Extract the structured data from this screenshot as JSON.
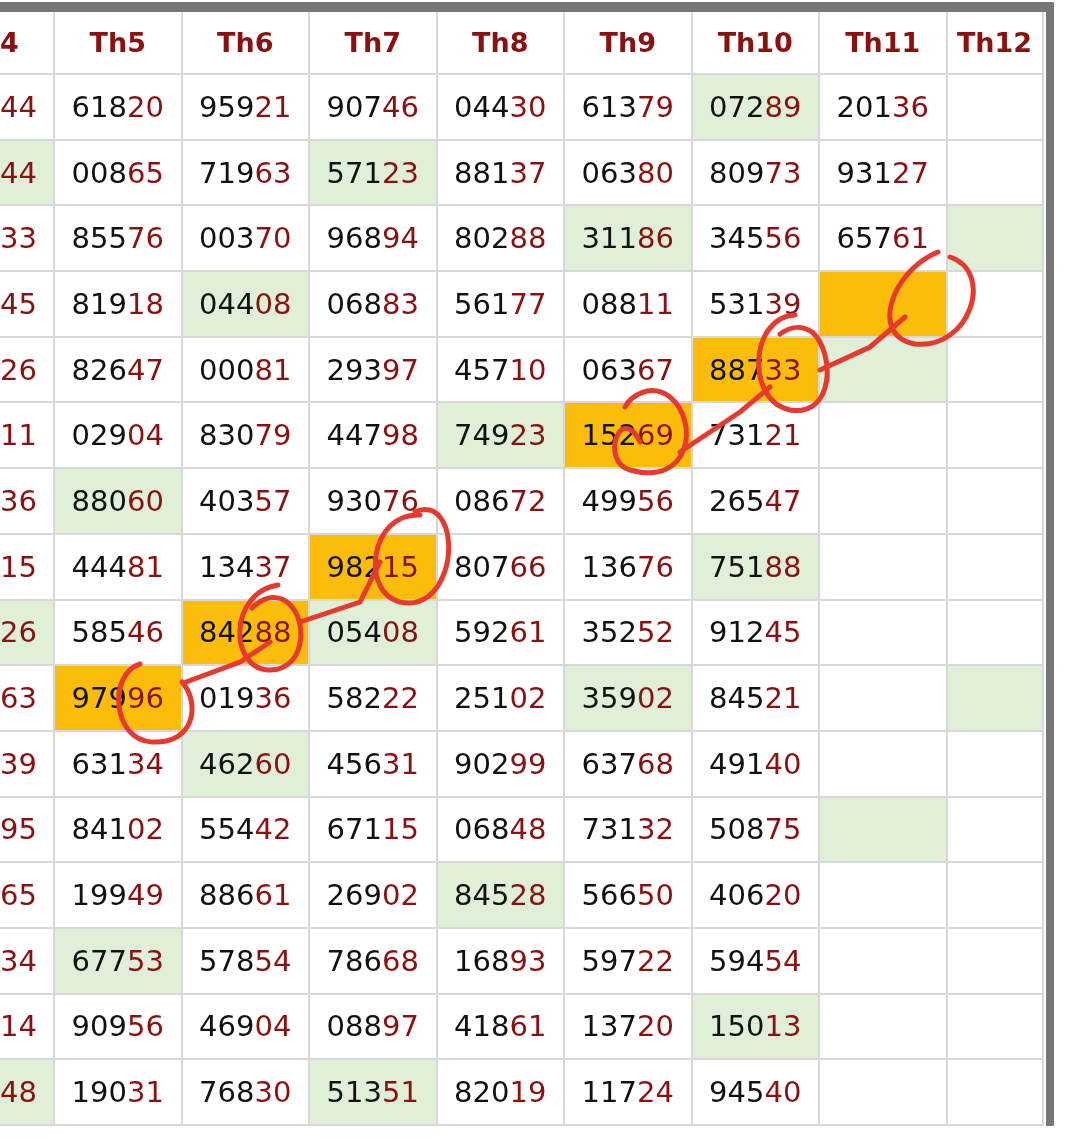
{
  "table": {
    "columns": [
      "4",
      "Th5",
      "Th6",
      "Th7",
      "Th8",
      "Th9",
      "Th10",
      "Th11",
      "Th12"
    ],
    "rows": [
      {
        "cells": [
          {
            "value": "44",
            "hit": false,
            "picked": false
          },
          {
            "value": "61820",
            "hit": false,
            "picked": false
          },
          {
            "value": "95921",
            "hit": false,
            "picked": false
          },
          {
            "value": "90746",
            "hit": false,
            "picked": false
          },
          {
            "value": "04430",
            "hit": false,
            "picked": false
          },
          {
            "value": "61379",
            "hit": false,
            "picked": false
          },
          {
            "value": "07289",
            "hit": true,
            "picked": false
          },
          {
            "value": "20136",
            "hit": false,
            "picked": false
          },
          {
            "hit": false,
            "picked": false
          }
        ]
      },
      {
        "cells": [
          {
            "value": "44",
            "hit": true,
            "picked": false
          },
          {
            "value": "00865",
            "hit": false,
            "picked": false
          },
          {
            "value": "71963",
            "hit": false,
            "picked": false
          },
          {
            "value": "57123",
            "hit": true,
            "picked": false
          },
          {
            "value": "88137",
            "hit": false,
            "picked": false
          },
          {
            "value": "06380",
            "hit": false,
            "picked": false
          },
          {
            "value": "80973",
            "hit": false,
            "picked": false
          },
          {
            "value": "93127",
            "hit": false,
            "picked": false
          },
          {
            "hit": false,
            "picked": false
          }
        ]
      },
      {
        "cells": [
          {
            "value": "33",
            "hit": false,
            "picked": false
          },
          {
            "value": "85576",
            "hit": false,
            "picked": false
          },
          {
            "value": "00370",
            "hit": false,
            "picked": false
          },
          {
            "value": "96894",
            "hit": false,
            "picked": false
          },
          {
            "value": "80288",
            "hit": false,
            "picked": false
          },
          {
            "value": "31186",
            "hit": true,
            "picked": false
          },
          {
            "value": "34556",
            "hit": false,
            "picked": false
          },
          {
            "value": "65761",
            "hit": false,
            "picked": false
          },
          {
            "hit": true,
            "picked": false
          }
        ]
      },
      {
        "cells": [
          {
            "value": "45",
            "hit": false,
            "picked": false
          },
          {
            "value": "81918",
            "hit": false,
            "picked": false
          },
          {
            "value": "04408",
            "hit": true,
            "picked": false
          },
          {
            "value": "06883",
            "hit": false,
            "picked": false
          },
          {
            "value": "56177",
            "hit": false,
            "picked": false
          },
          {
            "value": "08811",
            "hit": false,
            "picked": false
          },
          {
            "value": "53139",
            "hit": false,
            "picked": false
          },
          {
            "hit": false,
            "picked": true
          },
          {
            "hit": false,
            "picked": false
          }
        ]
      },
      {
        "cells": [
          {
            "value": "26",
            "hit": false,
            "picked": false
          },
          {
            "value": "82647",
            "hit": false,
            "picked": false
          },
          {
            "value": "00081",
            "hit": false,
            "picked": false
          },
          {
            "value": "29397",
            "hit": false,
            "picked": false
          },
          {
            "value": "45710",
            "hit": false,
            "picked": false
          },
          {
            "value": "06367",
            "hit": false,
            "picked": false
          },
          {
            "value": "88733",
            "hit": false,
            "picked": true
          },
          {
            "hit": true,
            "picked": false
          },
          {
            "hit": false,
            "picked": false
          }
        ]
      },
      {
        "cells": [
          {
            "value": "11",
            "hit": false,
            "picked": false
          },
          {
            "value": "02904",
            "hit": false,
            "picked": false
          },
          {
            "value": "83079",
            "hit": false,
            "picked": false
          },
          {
            "value": "44798",
            "hit": false,
            "picked": false
          },
          {
            "value": "74923",
            "hit": true,
            "picked": false
          },
          {
            "value": "15269",
            "hit": false,
            "picked": true
          },
          {
            "value": "73121",
            "hit": false,
            "picked": false
          },
          {
            "hit": false,
            "picked": false
          },
          {
            "hit": false,
            "picked": false
          }
        ]
      },
      {
        "cells": [
          {
            "value": "36",
            "hit": false,
            "picked": false
          },
          {
            "value": "88060",
            "hit": true,
            "picked": false
          },
          {
            "value": "40357",
            "hit": false,
            "picked": false
          },
          {
            "value": "93076",
            "hit": false,
            "picked": false
          },
          {
            "value": "08672",
            "hit": false,
            "picked": false
          },
          {
            "value": "49956",
            "hit": false,
            "picked": false
          },
          {
            "value": "26547",
            "hit": false,
            "picked": false
          },
          {
            "hit": false,
            "picked": false
          },
          {
            "hit": false,
            "picked": false
          }
        ]
      },
      {
        "cells": [
          {
            "value": "15",
            "hit": false,
            "picked": false
          },
          {
            "value": "44481",
            "hit": false,
            "picked": false
          },
          {
            "value": "13437",
            "hit": false,
            "picked": false
          },
          {
            "value": "98215",
            "hit": false,
            "picked": true
          },
          {
            "value": "80766",
            "hit": false,
            "picked": false
          },
          {
            "value": "13676",
            "hit": false,
            "picked": false
          },
          {
            "value": "75188",
            "hit": true,
            "picked": false
          },
          {
            "hit": false,
            "picked": false
          },
          {
            "hit": false,
            "picked": false
          }
        ]
      },
      {
        "cells": [
          {
            "value": "26",
            "hit": true,
            "picked": false
          },
          {
            "value": "58546",
            "hit": false,
            "picked": false
          },
          {
            "value": "84288",
            "hit": false,
            "picked": true
          },
          {
            "value": "05408",
            "hit": true,
            "picked": false
          },
          {
            "value": "59261",
            "hit": false,
            "picked": false
          },
          {
            "value": "35252",
            "hit": false,
            "picked": false
          },
          {
            "value": "91245",
            "hit": false,
            "picked": false
          },
          {
            "hit": false,
            "picked": false
          },
          {
            "hit": false,
            "picked": false
          }
        ]
      },
      {
        "cells": [
          {
            "value": "63",
            "hit": false,
            "picked": false
          },
          {
            "value": "97996",
            "hit": false,
            "picked": true
          },
          {
            "value": "01936",
            "hit": false,
            "picked": false
          },
          {
            "value": "58222",
            "hit": false,
            "picked": false
          },
          {
            "value": "25102",
            "hit": false,
            "picked": false
          },
          {
            "value": "35902",
            "hit": true,
            "picked": false
          },
          {
            "value": "84521",
            "hit": false,
            "picked": false
          },
          {
            "hit": false,
            "picked": false
          },
          {
            "hit": true,
            "picked": false
          }
        ]
      },
      {
        "cells": [
          {
            "value": "39",
            "hit": false,
            "picked": false
          },
          {
            "value": "63134",
            "hit": false,
            "picked": false
          },
          {
            "value": "46260",
            "hit": true,
            "picked": false
          },
          {
            "value": "45631",
            "hit": false,
            "picked": false
          },
          {
            "value": "90299",
            "hit": false,
            "picked": false
          },
          {
            "value": "63768",
            "hit": false,
            "picked": false
          },
          {
            "value": "49140",
            "hit": false,
            "picked": false
          },
          {
            "hit": false,
            "picked": false
          },
          {
            "hit": false,
            "picked": false
          }
        ]
      },
      {
        "cells": [
          {
            "value": "95",
            "hit": false,
            "picked": false
          },
          {
            "value": "84102",
            "hit": false,
            "picked": false
          },
          {
            "value": "55442",
            "hit": false,
            "picked": false
          },
          {
            "value": "67115",
            "hit": false,
            "picked": false
          },
          {
            "value": "06848",
            "hit": false,
            "picked": false
          },
          {
            "value": "73132",
            "hit": false,
            "picked": false
          },
          {
            "value": "50875",
            "hit": false,
            "picked": false
          },
          {
            "hit": true,
            "picked": false
          },
          {
            "hit": false,
            "picked": false
          }
        ]
      },
      {
        "cells": [
          {
            "value": "65",
            "hit": false,
            "picked": false
          },
          {
            "value": "19949",
            "hit": false,
            "picked": false
          },
          {
            "value": "88661",
            "hit": false,
            "picked": false
          },
          {
            "value": "26902",
            "hit": false,
            "picked": false
          },
          {
            "value": "84528",
            "hit": true,
            "picked": false
          },
          {
            "value": "56650",
            "hit": false,
            "picked": false
          },
          {
            "value": "40620",
            "hit": false,
            "picked": false
          },
          {
            "hit": false,
            "picked": false
          },
          {
            "hit": false,
            "picked": false
          }
        ]
      },
      {
        "cells": [
          {
            "value": "34",
            "hit": false,
            "picked": false
          },
          {
            "value": "67753",
            "hit": true,
            "picked": false
          },
          {
            "value": "57854",
            "hit": false,
            "picked": false
          },
          {
            "value": "78668",
            "hit": false,
            "picked": false
          },
          {
            "value": "16893",
            "hit": false,
            "picked": false
          },
          {
            "value": "59722",
            "hit": false,
            "picked": false
          },
          {
            "value": "59454",
            "hit": false,
            "picked": false
          },
          {
            "hit": false,
            "picked": false
          },
          {
            "hit": false,
            "picked": false
          }
        ]
      },
      {
        "cells": [
          {
            "value": "14",
            "hit": false,
            "picked": false
          },
          {
            "value": "90956",
            "hit": false,
            "picked": false
          },
          {
            "value": "46904",
            "hit": false,
            "picked": false
          },
          {
            "value": "08897",
            "hit": false,
            "picked": false
          },
          {
            "value": "41861",
            "hit": false,
            "picked": false
          },
          {
            "value": "13720",
            "hit": false,
            "picked": false
          },
          {
            "value": "15013",
            "hit": true,
            "picked": false
          },
          {
            "hit": false,
            "picked": false
          },
          {
            "hit": false,
            "picked": false
          }
        ]
      },
      {
        "cells": [
          {
            "value": "48",
            "hit": true,
            "picked": false
          },
          {
            "value": "19031",
            "hit": false,
            "picked": false
          },
          {
            "value": "76830",
            "hit": false,
            "picked": false
          },
          {
            "value": "51351",
            "hit": true,
            "picked": false
          },
          {
            "value": "82019",
            "hit": false,
            "picked": false
          },
          {
            "value": "11724",
            "hit": false,
            "picked": false
          },
          {
            "value": "94540",
            "hit": false,
            "picked": false
          },
          {
            "hit": false,
            "picked": false
          },
          {
            "hit": false,
            "picked": false
          }
        ]
      }
    ]
  }
}
